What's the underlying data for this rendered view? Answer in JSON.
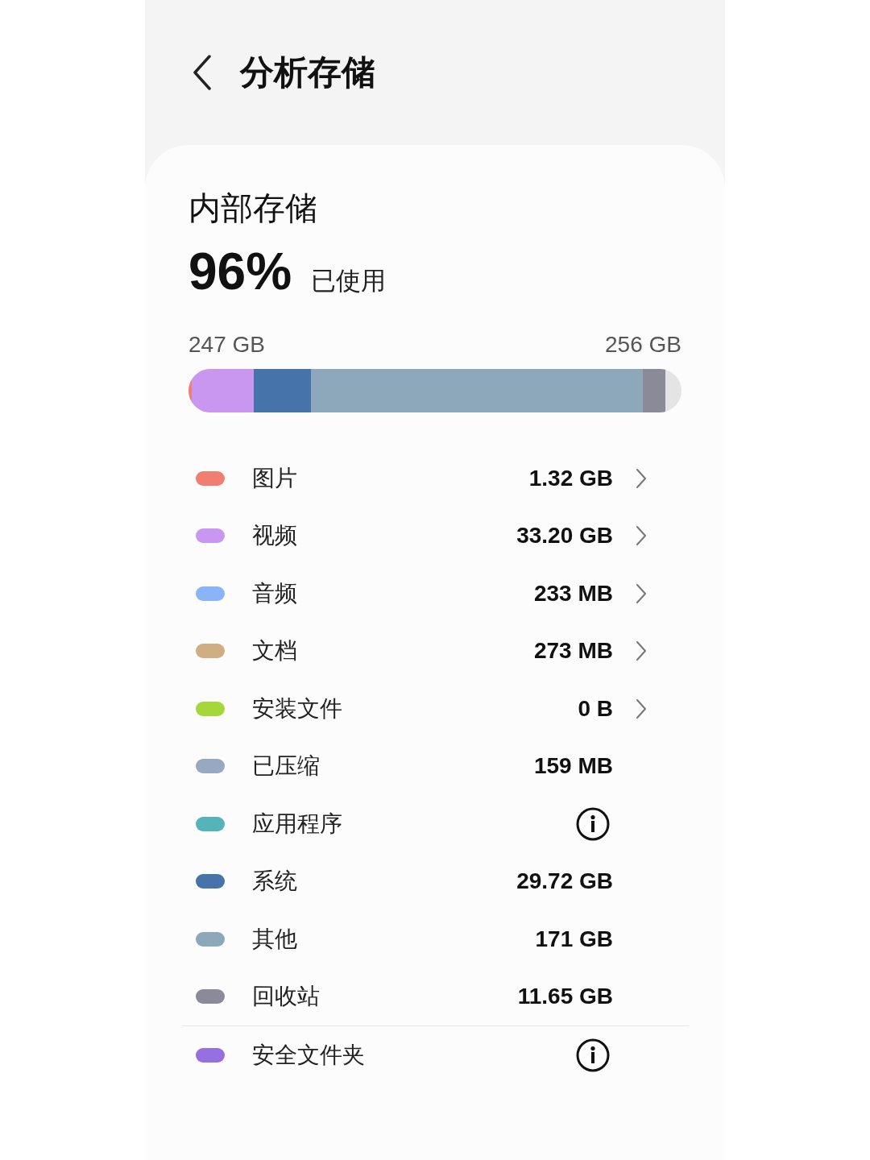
{
  "header": {
    "title": "分析存储"
  },
  "storage": {
    "title": "内部存储",
    "percent": "96%",
    "used_label": "已使用",
    "used_amount": "247 GB",
    "total": "256 GB",
    "bar": [
      {
        "color": "#f07f72"
      },
      {
        "color": "#c997ef"
      },
      {
        "color": "#4674aa"
      },
      {
        "color": "#8da8bb"
      },
      {
        "color": "#8a8a98"
      }
    ]
  },
  "categories": [
    {
      "kind": "link",
      "label": "图片",
      "value": "1.32 GB",
      "color": "#f07f72"
    },
    {
      "kind": "link",
      "label": "视频",
      "value": "33.20 GB",
      "color": "#c997ef"
    },
    {
      "kind": "link",
      "label": "音频",
      "value": "233 MB",
      "color": "#8ab4f8"
    },
    {
      "kind": "link",
      "label": "文档",
      "value": "273 MB",
      "color": "#d1ae82"
    },
    {
      "kind": "link",
      "label": "安装文件",
      "value": "0 B",
      "color": "#a5d63a"
    },
    {
      "kind": "plain",
      "label": "已压缩",
      "value": "159 MB",
      "color": "#97a8c2"
    },
    {
      "kind": "info",
      "label": "应用程序",
      "color": "#55b4b8"
    },
    {
      "kind": "plain",
      "label": "系统",
      "value": "29.72 GB",
      "color": "#4674aa"
    },
    {
      "kind": "plain",
      "label": "其他",
      "value": "171 GB",
      "color": "#8da8bb"
    },
    {
      "kind": "plain",
      "label": "回收站",
      "value": "11.65 GB",
      "color": "#8a8a98"
    }
  ],
  "secure_rows": [
    {
      "kind": "info",
      "label": "安全文件夹",
      "color": "#9470e0"
    }
  ]
}
